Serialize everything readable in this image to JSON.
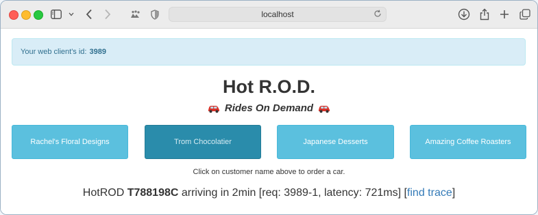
{
  "browser": {
    "url": "localhost",
    "icons": [
      "sidebar-icon",
      "chevron-down-icon",
      "back-icon",
      "forward-icon",
      "extension-icon",
      "shield-icon",
      "reload-icon",
      "download-icon",
      "share-icon",
      "new-tab-icon",
      "tabs-overview-icon"
    ]
  },
  "alert": {
    "prefix": "Your web client's id:",
    "client_id": "3989"
  },
  "page": {
    "title": "Hot R.O.D.",
    "subtitle": "Rides On Demand",
    "hint": "Click on customer name above to order a car."
  },
  "customers": [
    {
      "label": "Rachel's Floral Designs"
    },
    {
      "label": "Trom Chocolatier"
    },
    {
      "label": "Japanese Desserts"
    },
    {
      "label": "Amazing Coffee Roasters"
    }
  ],
  "status": {
    "prefix": "HotROD",
    "vehicle": "T788198C",
    "details": "arriving in 2min [req: 3989-1, latency: 721ms] [",
    "link": "find trace",
    "suffix": "]"
  },
  "colors": {
    "alert_bg": "#d9edf7",
    "button": "#5bc0de",
    "button_active": "#2a8cab",
    "link": "#337ab7"
  }
}
